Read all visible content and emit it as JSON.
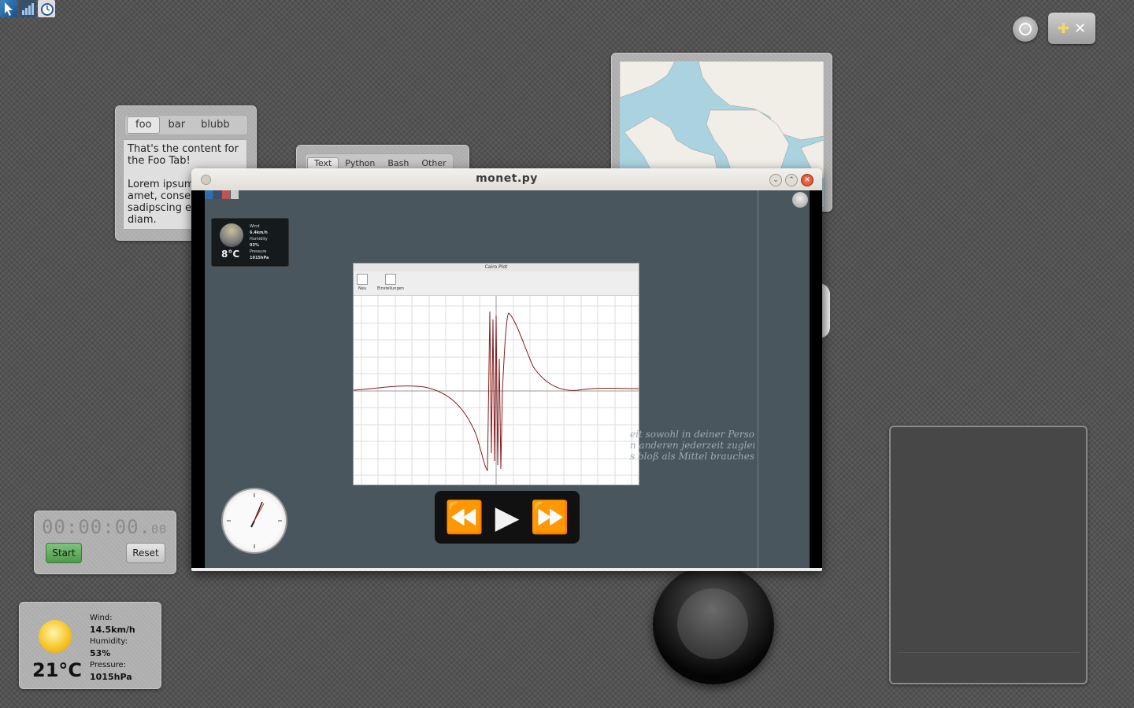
{
  "tray": {
    "icons": [
      "cursor-icon",
      "signal-bars-icon",
      "clock-icon"
    ]
  },
  "topright": {
    "circle_icon": "ring-icon",
    "tools_icon": "plus-wrench-icon",
    "plus_glyph": "✚",
    "tool_glyph": "✕"
  },
  "tabwidget": {
    "tabs": [
      "foo",
      "bar",
      "blubb"
    ],
    "content_line1": "That's the content for the Foo Tab!",
    "content_line2": "Lorem ipsum",
    "content_line3": "amet, conset",
    "content_line4": "sadipscing el",
    "content_line5": "diam."
  },
  "codewidget": {
    "tabs": [
      "Text",
      "Python",
      "Bash",
      "Other"
    ]
  },
  "window": {
    "title": "monet.py",
    "min_glyph": "⌄",
    "max_glyph": "⌃",
    "close_glyph": "✕"
  },
  "inner": {
    "weather": {
      "temp": "8°C",
      "wind_label": "Wind",
      "wind": "6.4km/h",
      "humidity_label": "Humidity",
      "humidity": "93%",
      "pressure_label": "Pressure",
      "pressure": "1015hPa"
    },
    "plot": {
      "title": "Cairo Plot",
      "tool_new": "Neu",
      "tool_settings": "Einstellungen"
    },
    "quote_line1": "eit sowohl in deiner Person,",
    "quote_line2": "n anderen jederzeit zugleich",
    "quote_line3": "s bloß als Mittel brauchest.",
    "media": {
      "rewind": "⏪",
      "play": "▶",
      "forward": "⏩"
    }
  },
  "stopwatch": {
    "time_main": "00:00:00.",
    "time_frac": "00",
    "start": "Start",
    "reset": "Reset"
  },
  "weather": {
    "temp": "21°C",
    "wind_label": "Wind:",
    "wind": "14.5km/h",
    "humidity_label": "Humidity:",
    "humidity": "53%",
    "pressure_label": "Pressure:",
    "pressure": "1015hPa"
  },
  "colors": {
    "accent_green": "#5aa657",
    "close_red": "#d44522",
    "desk": "#49565d",
    "plot_line": "#8b1a1a"
  }
}
